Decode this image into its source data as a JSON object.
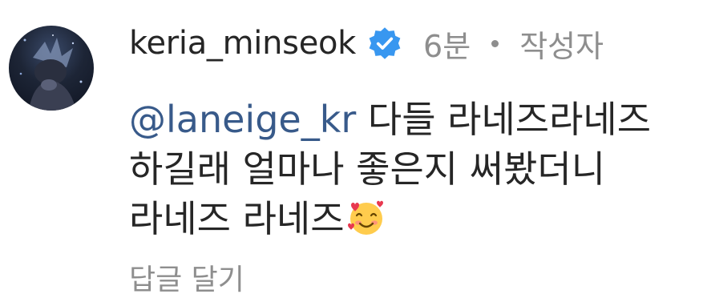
{
  "comment": {
    "username": "keria_minseok",
    "verified_icon": "verified-badge-icon",
    "time": "6분",
    "author_label": "작성자",
    "mention": "@laneige_kr",
    "line1_rest": " 다들 라네즈라네즈",
    "line2": "하길래 얼마나 좋은지 써봤더니",
    "line3": "라네즈 라네즈",
    "emoji_icon": "smiling-face-with-hearts-icon",
    "reply_label": "답글 달기"
  },
  "colors": {
    "text": "#262626",
    "secondary": "#8e8e8e",
    "mention": "#385a8a",
    "verified": "#3897f0"
  }
}
